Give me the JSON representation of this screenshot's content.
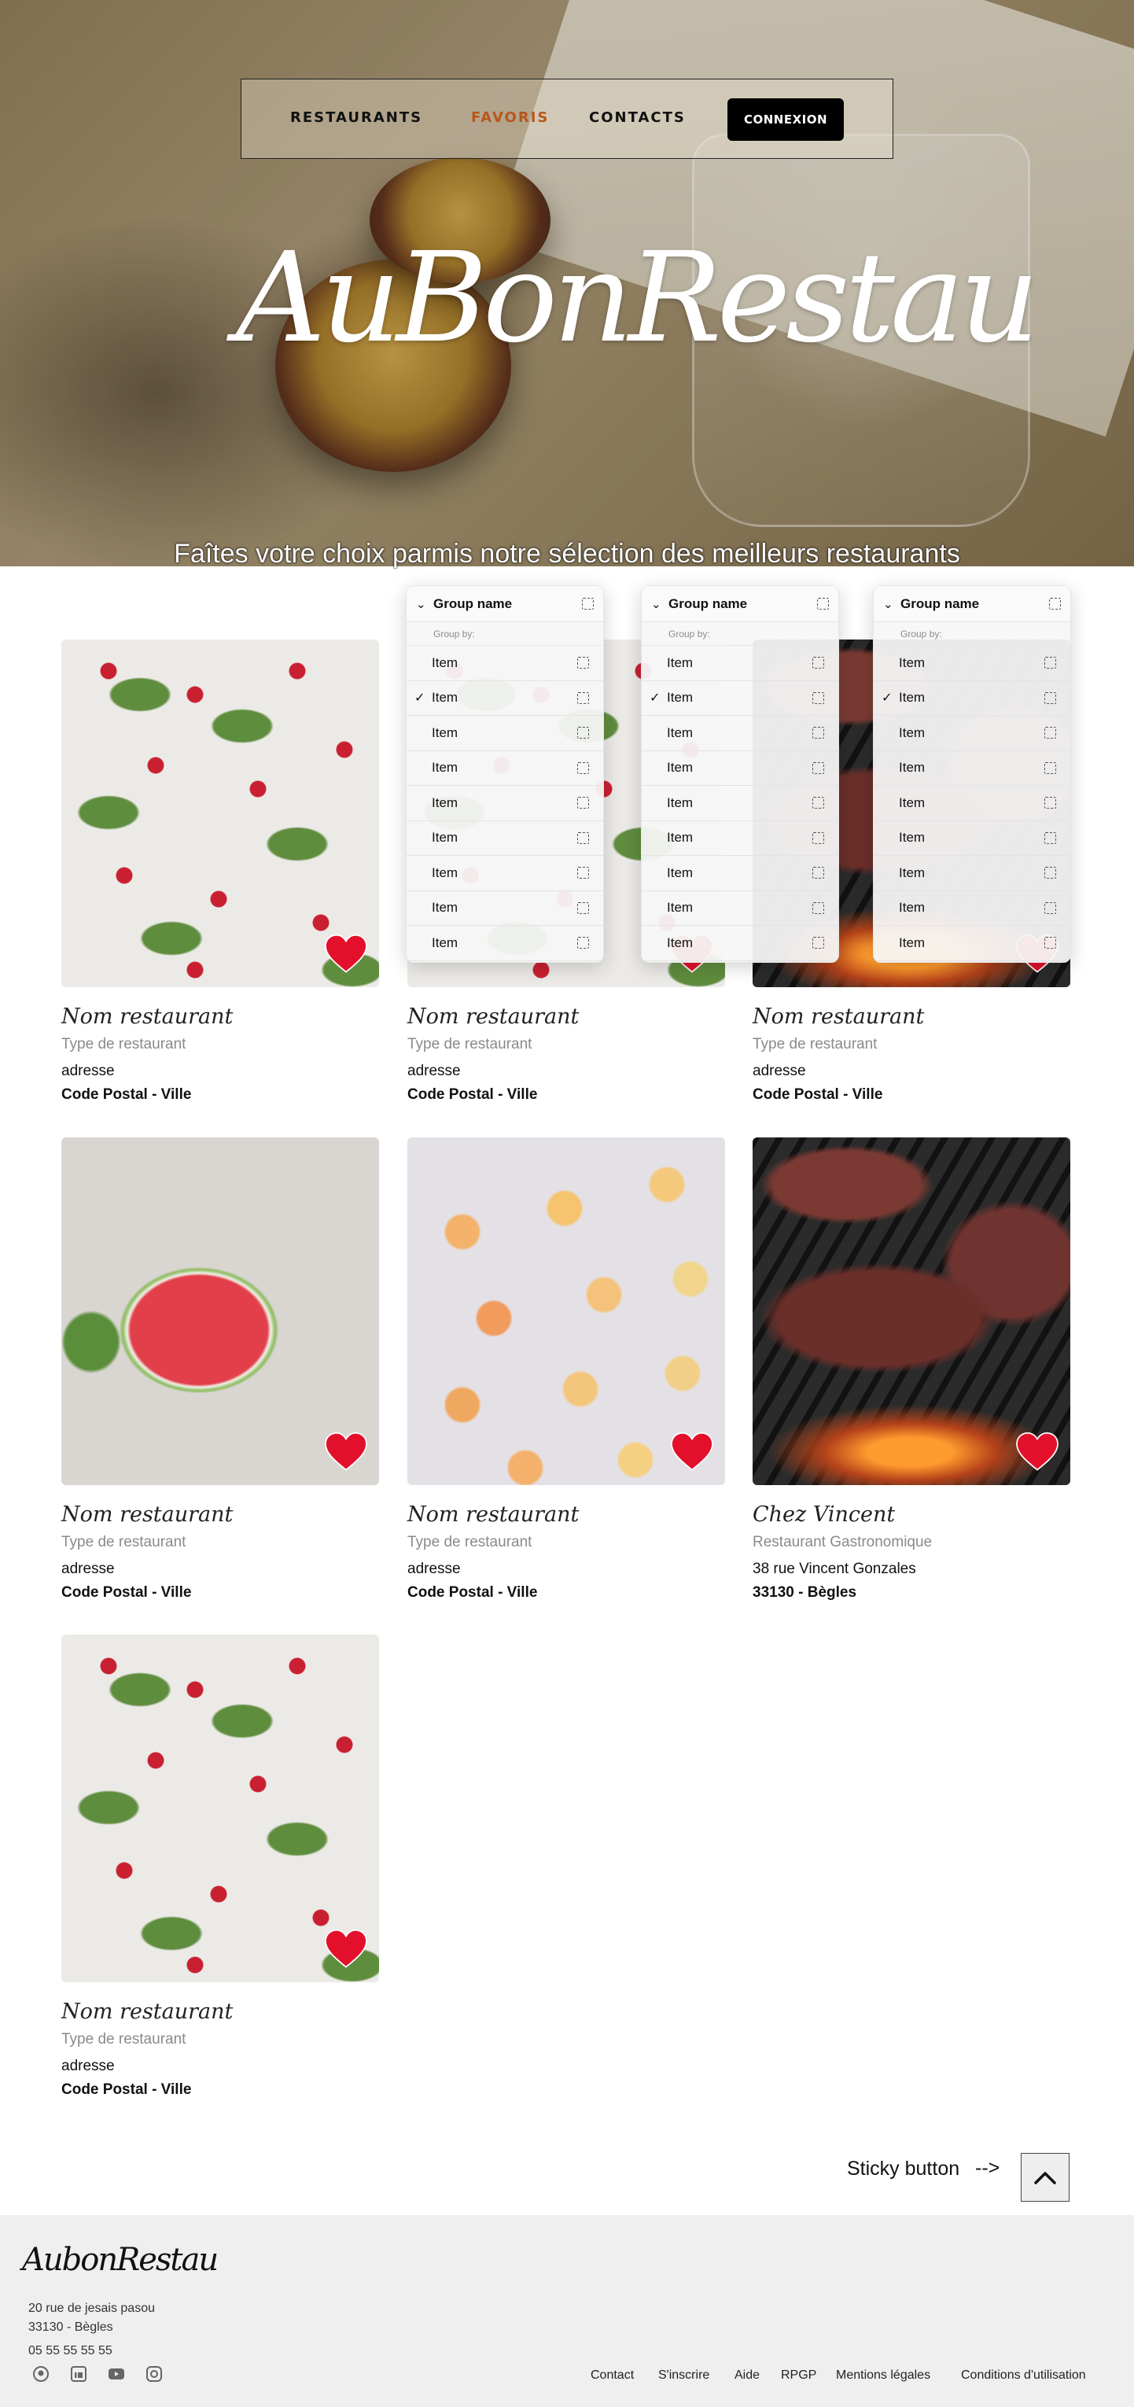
{
  "nav": {
    "links": [
      "RESTAURANTS",
      "FAVORIS",
      "CONTACTS"
    ],
    "active": "FAVORIS",
    "login": "CONNEXION"
  },
  "hero": {
    "logo": "AuBonRestau",
    "tagline": "Faîtes votre choix parmis notre sélection des meilleurs restaurants"
  },
  "restaurants": [
    {
      "name": "Nom restaurant",
      "type": "Type de restaurant",
      "address": "adresse",
      "city": "Code Postal - Ville",
      "image": "radish-photo"
    },
    {
      "name": "Nom restaurant",
      "type": "Type de restaurant",
      "address": "adresse",
      "city": "Code Postal - Ville",
      "image": "food-photo"
    },
    {
      "name": "Nom restaurant",
      "type": "Type de restaurant",
      "address": "adresse",
      "city": "Code Postal - Ville",
      "image": "food-photo"
    },
    {
      "name": "Nom restaurant",
      "type": "Type de restaurant",
      "address": "adresse",
      "city": "Code Postal - Ville",
      "image": "watermelon-photo"
    },
    {
      "name": "Nom restaurant",
      "type": "Type de restaurant",
      "address": "adresse",
      "city": "Code Postal - Ville",
      "image": "cherry-photo"
    },
    {
      "name": "Chez Vincent",
      "type": "Restaurant Gastronomique",
      "address": "38 rue Vincent Gonzales",
      "city": "33130 - Bègles",
      "image": "grill-photo"
    },
    {
      "name": "Nom restaurant",
      "type": "Type de restaurant",
      "address": "adresse",
      "city": "Code Postal - Ville",
      "image": "radish-photo"
    }
  ],
  "dropdown": {
    "group_name": "Group name",
    "group_by": "Group by:",
    "items": [
      "Item",
      "Item",
      "Item",
      "Item",
      "Item",
      "Item",
      "Item",
      "Item",
      "Item"
    ],
    "checked_index": 1
  },
  "sticky": {
    "label": "Sticky button",
    "arrow": "-->"
  },
  "footer": {
    "logo": "AubonRestau",
    "address_line1": "20 rue de jesais pasou",
    "address_line2": "33130 - Bègles",
    "phone": "05 55 55 55 55",
    "social_icons": [
      "github-icon",
      "linkedin-icon",
      "youtube-icon",
      "instagram-icon"
    ],
    "links": [
      "Contact",
      "S'inscrire",
      "Aide",
      "RPGP",
      "Mentions légales",
      "Conditions d'utilisation"
    ]
  },
  "colors": {
    "accent": "#b9561a",
    "heart": "#e3102b",
    "footer_bg": "#efefef"
  }
}
